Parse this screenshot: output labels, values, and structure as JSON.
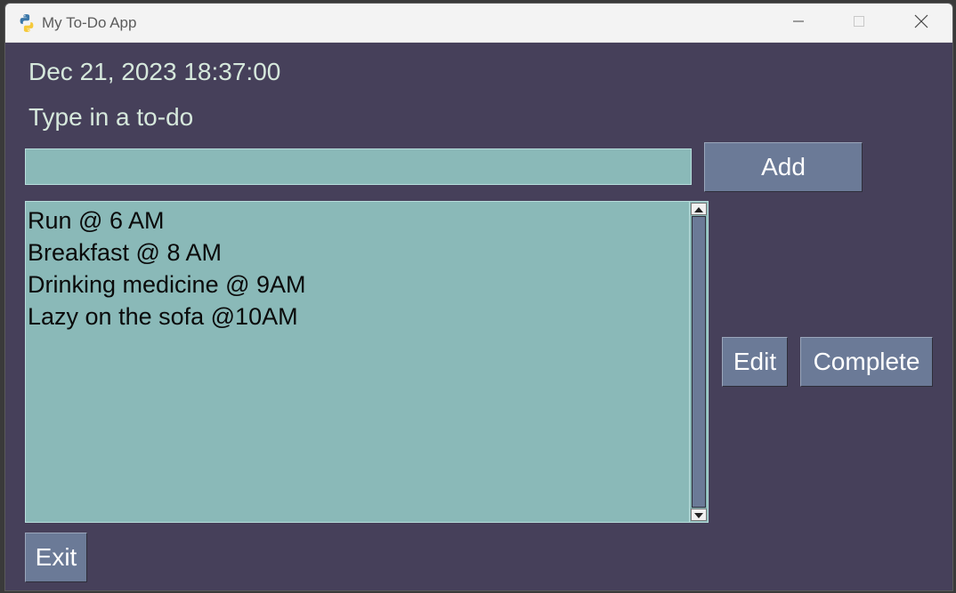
{
  "window": {
    "title": "My To-Do App",
    "minimize_icon": "minimize-icon",
    "maximize_icon": "maximize-icon",
    "close_icon": "close-icon",
    "app_icon": "python-logo-icon"
  },
  "clock": {
    "text": "Dec 21, 2023 18:37:00"
  },
  "prompt": {
    "text": "Type in a to-do"
  },
  "input": {
    "value": "",
    "placeholder": ""
  },
  "buttons": {
    "add": "Add",
    "edit": "Edit",
    "complete": "Complete",
    "exit": "Exit"
  },
  "todos": [
    "Run @ 6 AM",
    "Breakfast @ 8 AM",
    "Drinking medicine @ 9AM",
    "Lazy on the sofa @10AM"
  ],
  "colors": {
    "background": "#46405a",
    "field": "#8ab9b8",
    "button": "#6b7a97",
    "label_text": "#d6e8dc"
  }
}
